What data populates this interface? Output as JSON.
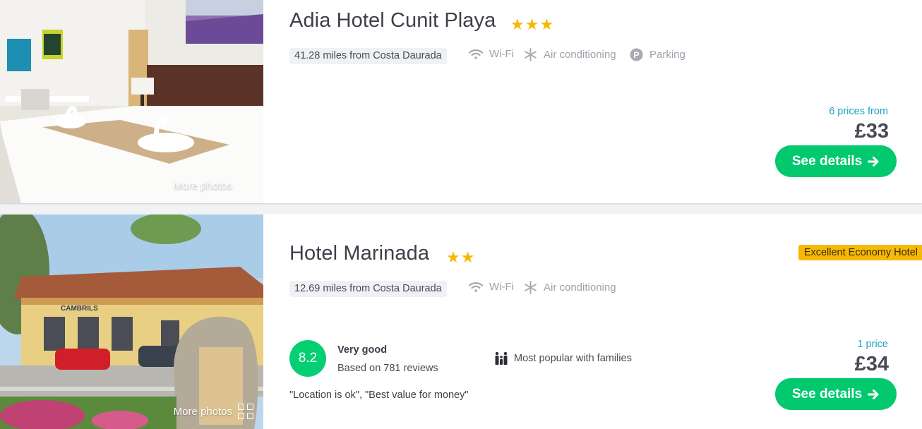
{
  "hotels": [
    {
      "name": "Adia Hotel Cunit Playa",
      "stars": "★★★",
      "distance": "41.28 miles from Costa Daurada",
      "amenities": [
        "Wi-Fi",
        "Air conditioning",
        "Parking"
      ],
      "prices_label": "6 prices from",
      "price": "£33",
      "cta": "See details",
      "more_photos": "More photos"
    },
    {
      "name": "Hotel Marinada",
      "stars": "★★",
      "badge": "Excellent Economy Hotel",
      "distance": "12.69 miles from Costa Daurada",
      "amenities": [
        "Wi-Fi",
        "Air conditioning"
      ],
      "score": "8.2",
      "rating_label": "Very good",
      "rating_sub": "Based on 781 reviews",
      "family_label": "Most popular with families",
      "quote": "\"Location is ok\", \"Best value for money\"",
      "prices_label": "1 price",
      "price": "£34",
      "cta": "See details",
      "more_photos": "More photos"
    }
  ],
  "icons": {
    "wifi": "wifi-icon",
    "ac": "snowflake-icon",
    "parking": "parking-icon",
    "family": "family-icon",
    "arrow": "arrow-right-icon",
    "grid": "grid-icon"
  },
  "colors": {
    "accent_green": "#03c96e",
    "star": "#f5b800",
    "badge": "#f7b907",
    "link_blue": "#1fa0c8"
  }
}
